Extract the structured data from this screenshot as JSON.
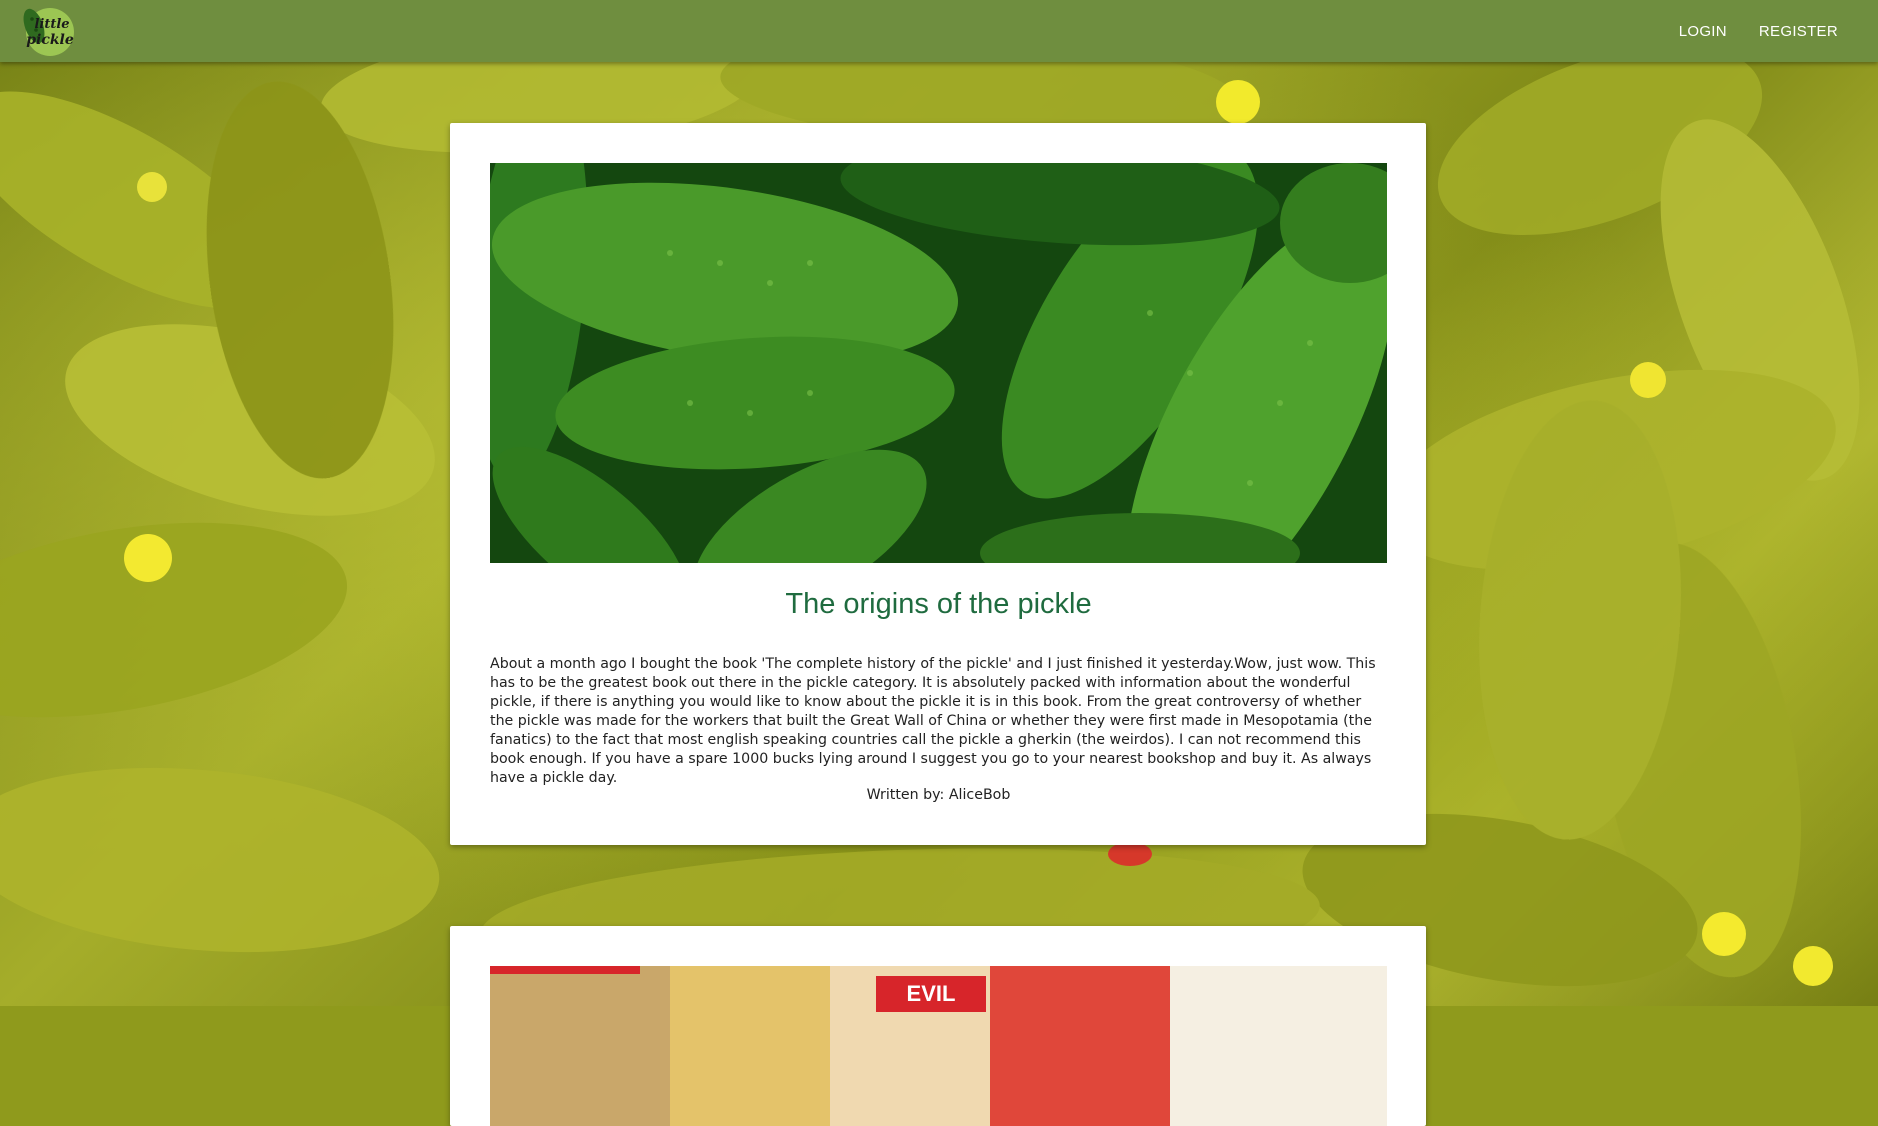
{
  "nav": {
    "logo_alt": "little pickle",
    "login": "LOGIN",
    "register": "REGISTER"
  },
  "posts": [
    {
      "title": "The origins of the pickle",
      "body": "About a month ago I bought the book 'The complete history of the pickle' and I just finished it yesterday.Wow, just wow. This has to be the greatest book out there in the pickle category. It is absolutely packed with information about the wonderful pickle, if there is anything you would like to know about the pickle it is in this book. From the great controversy of whether the pickle was made for the workers that built the Great Wall of China or whether they were first made in Mesopotamia (the fanatics) to the fact that most english speaking countries call the pickle a gherkin (the weirdos). I can not recommend this book enough. If you have a spare 1000 bucks lying around I suggest you go to your nearest bookshop and buy it. As always have a pickle day.",
      "author": "Written by: AliceBob"
    },
    {
      "image_text": "EVIL"
    }
  ],
  "colors": {
    "navbar": "#6f8e3f",
    "title": "#1f6b3f",
    "card": "#ffffff"
  }
}
